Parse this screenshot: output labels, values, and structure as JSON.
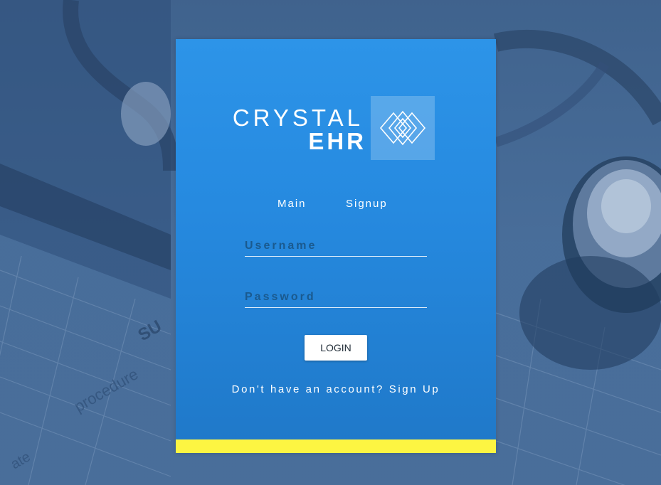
{
  "brand": {
    "name_line1": "CRYSTAL",
    "name_line2": "EHR",
    "logo_icon": "diamond-lattice-icon"
  },
  "nav": {
    "items": [
      {
        "label": "Main"
      },
      {
        "label": "Signup"
      }
    ]
  },
  "form": {
    "username": {
      "placeholder": "Username",
      "value": ""
    },
    "password": {
      "placeholder": "Password",
      "value": ""
    },
    "login_label": "LOGIN"
  },
  "footer": {
    "prompt": "Don't have an account?",
    "link_label": "Sign Up"
  },
  "colors": {
    "panel": "#2d94e8",
    "accent_bar": "#fdf542",
    "background": "#4a6f9b",
    "button_bg": "#ffffff"
  }
}
